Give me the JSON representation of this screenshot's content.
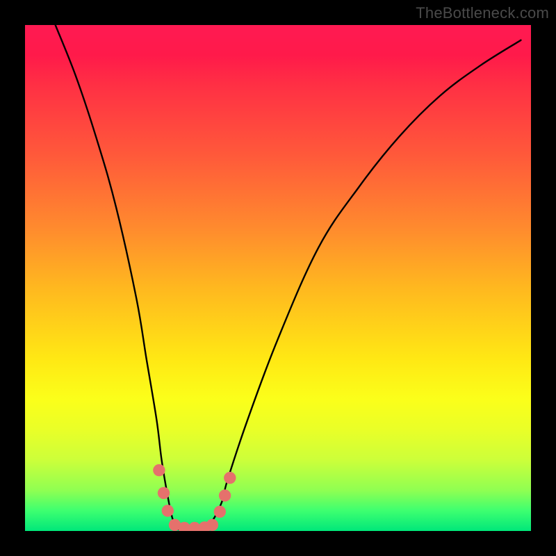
{
  "watermark": "TheBottleneck.com",
  "chart_data": {
    "type": "line",
    "title": "",
    "xlabel": "",
    "ylabel": "",
    "xlim": [
      0,
      100
    ],
    "ylim": [
      0,
      100
    ],
    "series": [
      {
        "name": "curve",
        "x": [
          6,
          10,
          14,
          18,
          22,
          24,
          26,
          27,
          28,
          29,
          30,
          31,
          33,
          35,
          37,
          39,
          40,
          44,
          50,
          58,
          66,
          74,
          82,
          90,
          98
        ],
        "y": [
          100,
          90,
          78,
          64,
          46,
          34,
          22,
          14,
          8,
          3,
          0.5,
          0.5,
          0.5,
          0.5,
          2,
          6,
          10,
          22,
          38,
          56,
          68,
          78,
          86,
          92,
          97
        ]
      }
    ],
    "markers": {
      "name": "highlight-dots",
      "color": "#e5716c",
      "points": [
        {
          "x": 26.5,
          "y": 12.0,
          "r": 1.2
        },
        {
          "x": 27.4,
          "y": 7.5,
          "r": 1.2
        },
        {
          "x": 28.2,
          "y": 4.0,
          "r": 1.2
        },
        {
          "x": 29.6,
          "y": 1.2,
          "r": 1.2
        },
        {
          "x": 31.5,
          "y": 0.6,
          "r": 1.2
        },
        {
          "x": 33.5,
          "y": 0.6,
          "r": 1.2
        },
        {
          "x": 35.5,
          "y": 0.7,
          "r": 1.2
        },
        {
          "x": 37.0,
          "y": 1.2,
          "r": 1.2
        },
        {
          "x": 38.5,
          "y": 3.8,
          "r": 1.2
        },
        {
          "x": 39.5,
          "y": 7.0,
          "r": 1.2
        },
        {
          "x": 40.5,
          "y": 10.5,
          "r": 1.2
        }
      ]
    },
    "gradient_stops": [
      {
        "pos": 0,
        "color": "#ff1a52"
      },
      {
        "pos": 40,
        "color": "#ff8a2e"
      },
      {
        "pos": 70,
        "color": "#fff014"
      },
      {
        "pos": 100,
        "color": "#00e77a"
      }
    ]
  }
}
